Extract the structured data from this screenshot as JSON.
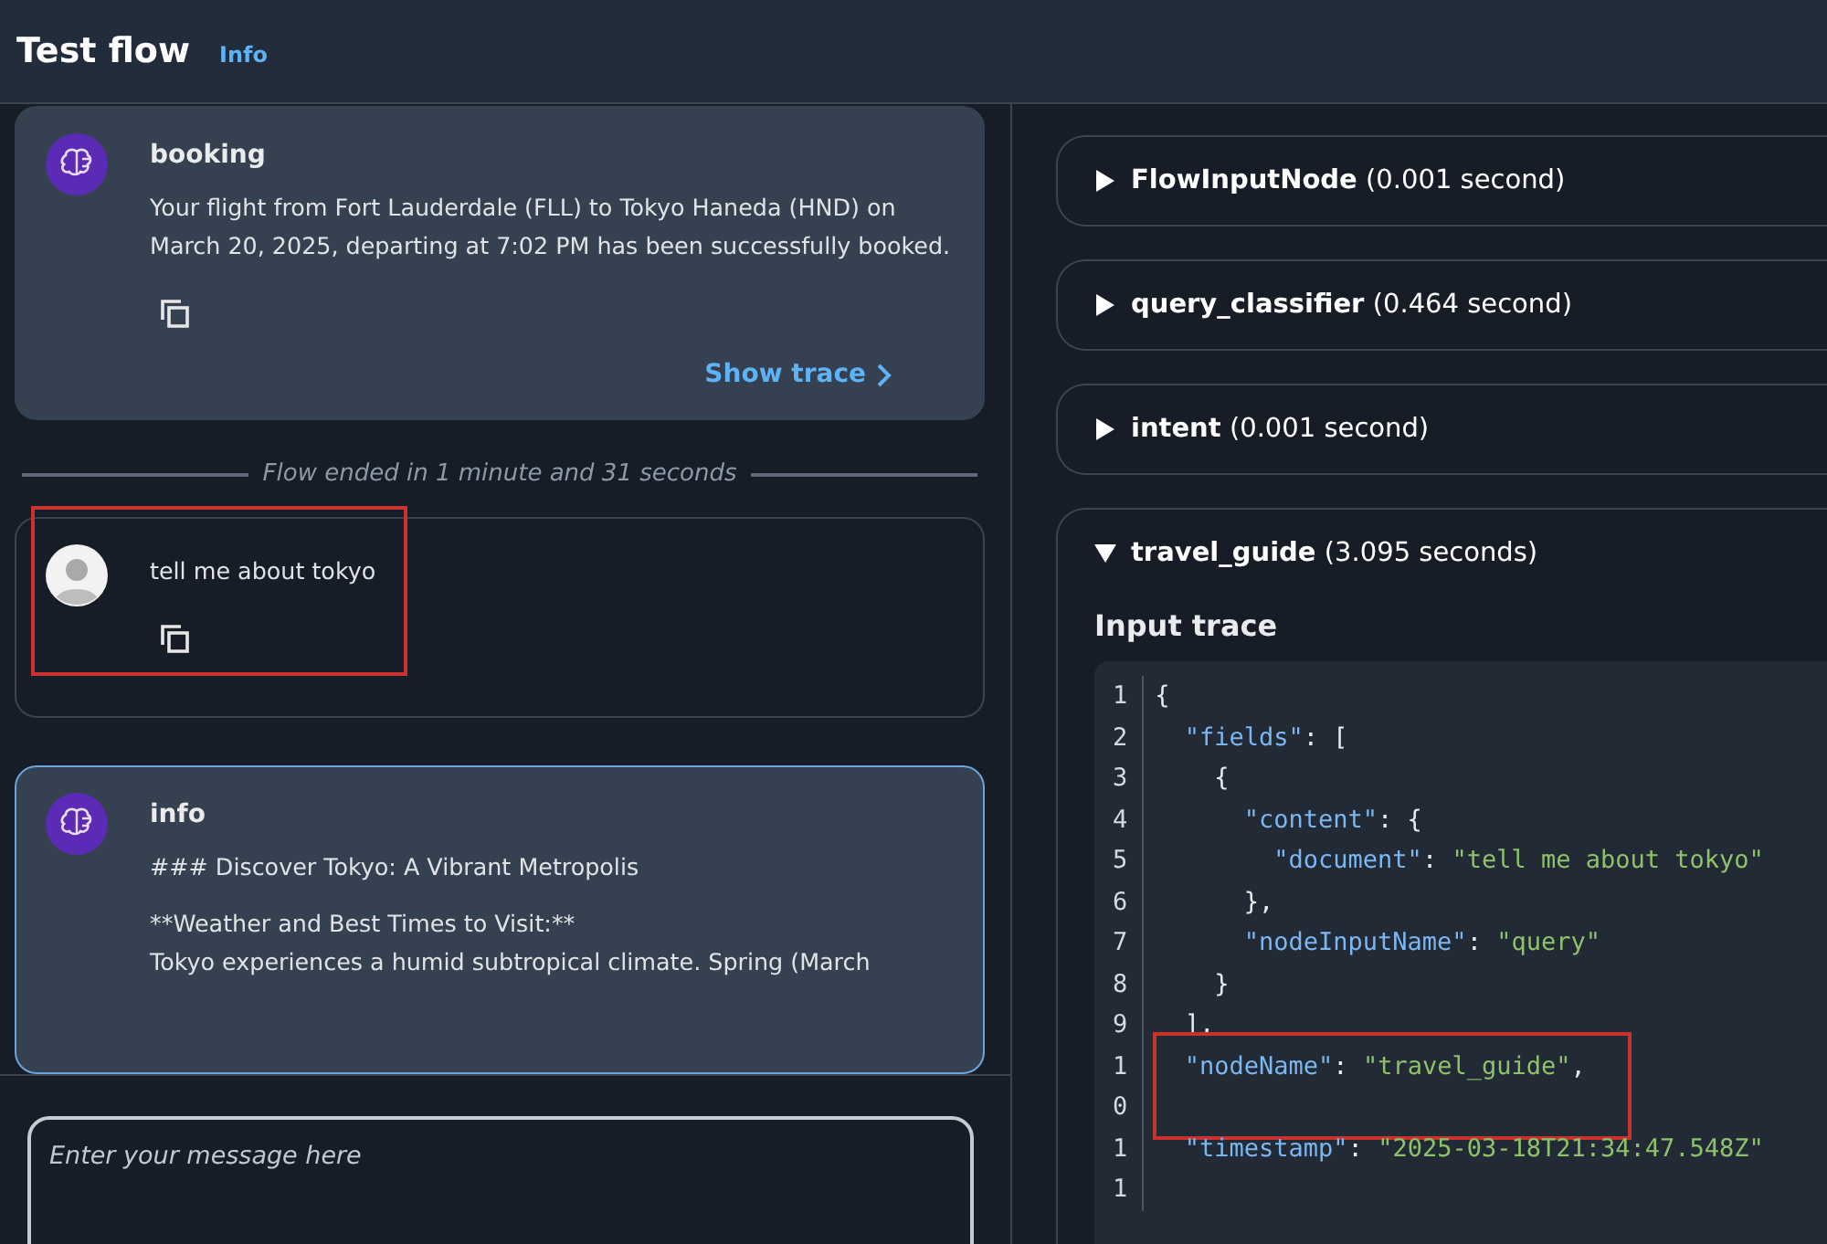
{
  "header": {
    "title": "Test flow",
    "info_link": "Info"
  },
  "messages": [
    {
      "kind": "bot",
      "sender": "booking",
      "paragraphs": [
        "Your flight from Fort Lauderdale (FLL) to Tokyo Haneda (HND) on March 20, 2025, departing at 7:02 PM has been successfully booked."
      ],
      "show_trace": "Show trace",
      "highlighted": false,
      "focused": false
    },
    {
      "kind": "separator",
      "text": "Flow ended in 1 minute and 31 seconds"
    },
    {
      "kind": "user",
      "paragraphs": [
        "tell me about tokyo"
      ],
      "highlighted": true,
      "focused": false
    },
    {
      "kind": "bot",
      "sender": "info",
      "paragraphs": [
        "### Discover Tokyo: A Vibrant Metropolis",
        "**Weather and Best Times to Visit:**\nTokyo experiences a humid subtropical climate. Spring (March"
      ],
      "highlighted": false,
      "focused": true
    }
  ],
  "input": {
    "placeholder": "Enter your message here"
  },
  "trace_nodes": [
    {
      "name": "FlowInputNode",
      "duration": "(0.001 second)",
      "expanded": false
    },
    {
      "name": "query_classifier",
      "duration": "(0.464 second)",
      "expanded": false
    },
    {
      "name": "intent",
      "duration": "(0.001 second)",
      "expanded": false
    },
    {
      "name": "travel_guide",
      "duration": "(3.095 seconds)",
      "expanded": true,
      "section_title": "Input trace",
      "code": [
        {
          "number": "1",
          "highlighted": false,
          "parts": [
            {
              "kind": "punct",
              "text": "{"
            }
          ]
        },
        {
          "number": "2",
          "highlighted": false,
          "parts": [
            {
              "kind": "key",
              "text": "  \"fields\""
            },
            {
              "kind": "punct",
              "text": ": ["
            }
          ]
        },
        {
          "number": "3",
          "highlighted": false,
          "parts": [
            {
              "kind": "punct",
              "text": "    {"
            }
          ]
        },
        {
          "number": "4",
          "highlighted": false,
          "parts": [
            {
              "kind": "key",
              "text": "      \"content\""
            },
            {
              "kind": "punct",
              "text": ": {"
            }
          ]
        },
        {
          "number": "5",
          "highlighted": false,
          "parts": [
            {
              "kind": "key",
              "text": "        \"document\""
            },
            {
              "kind": "punct",
              "text": ": "
            },
            {
              "kind": "string",
              "text": "\"tell me about tokyo\""
            }
          ]
        },
        {
          "number": "6",
          "highlighted": false,
          "parts": [
            {
              "kind": "punct",
              "text": "      },"
            }
          ]
        },
        {
          "number": "7",
          "highlighted": false,
          "parts": [
            {
              "kind": "key",
              "text": "      \"nodeInputName\""
            },
            {
              "kind": "punct",
              "text": ": "
            },
            {
              "kind": "string",
              "text": "\"query\""
            }
          ]
        },
        {
          "number": "8",
          "highlighted": false,
          "parts": [
            {
              "kind": "punct",
              "text": "    }"
            }
          ]
        },
        {
          "number": "9",
          "highlighted": false,
          "parts": [
            {
              "kind": "punct",
              "text": "  ],"
            }
          ]
        },
        {
          "number": "10",
          "highlighted": true,
          "parts": [
            {
              "kind": "key",
              "text": "  \"nodeName\""
            },
            {
              "kind": "punct",
              "text": ": "
            },
            {
              "kind": "string",
              "text": "\"travel_guide\""
            },
            {
              "kind": "punct",
              "text": ","
            }
          ]
        },
        {
          "number": "11",
          "highlighted": false,
          "parts": [
            {
              "kind": "key",
              "text": "  \"timestamp\""
            },
            {
              "kind": "punct",
              "text": ": "
            },
            {
              "kind": "string",
              "text": "\"2025-03-18T21:34:47.548Z\""
            }
          ]
        }
      ]
    }
  ]
}
